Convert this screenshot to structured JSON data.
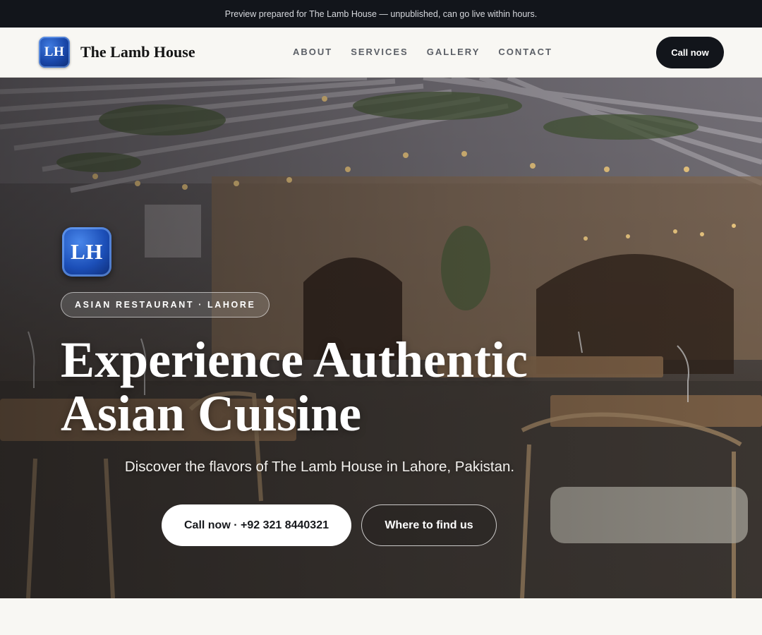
{
  "banner": {
    "text": "Preview prepared for The Lamb House — unpublished, can go live within hours."
  },
  "header": {
    "logo_text": "LH",
    "brand_name": "The Lamb House",
    "nav": [
      {
        "label": "ABOUT"
      },
      {
        "label": "SERVICES"
      },
      {
        "label": "GALLERY"
      },
      {
        "label": "CONTACT"
      }
    ],
    "call_label": "Call now"
  },
  "hero": {
    "logo_text": "LH",
    "tag": "ASIAN RESTAURANT · LAHORE",
    "headline_line1": "Experience Authentic",
    "headline_line2": "Asian Cuisine",
    "subtitle": "Discover the flavors of The Lamb House in Lahore, Pakistan.",
    "primary_cta": "Call now · +92 321 8440321",
    "secondary_cta": "Where to find us",
    "background_icon": "restaurant-interior-photo"
  },
  "colors": {
    "dark": "#12151b",
    "logo_blue": "#1846a8",
    "page_bg": "#f8f7f3"
  }
}
